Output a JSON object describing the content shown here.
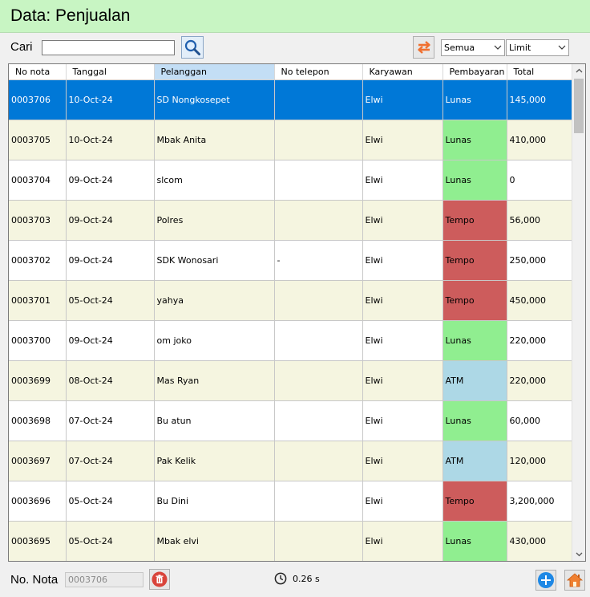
{
  "window": {
    "title": "Data: Penjualan"
  },
  "toolbar": {
    "search_label": "Cari",
    "search_value": "",
    "status_filter": "Semua",
    "limit_filter": "Limit"
  },
  "table": {
    "columns": [
      "No nota",
      "Tanggal",
      "Pelanggan",
      "No telepon",
      "Karyawan",
      "Pembayaran",
      "Total"
    ],
    "sorted_column": "Pelanggan",
    "rows": [
      {
        "no_nota": "0003706",
        "tanggal": "10-Oct-24",
        "pelanggan": "SD Nongkosepet",
        "no_telepon": "",
        "karyawan": "Elwi",
        "pembayaran": "Lunas",
        "total": "145,000",
        "selected": true
      },
      {
        "no_nota": "0003705",
        "tanggal": "10-Oct-24",
        "pelanggan": "Mbak Anita",
        "no_telepon": "",
        "karyawan": "Elwi",
        "pembayaran": "Lunas",
        "total": "410,000"
      },
      {
        "no_nota": "0003704",
        "tanggal": "09-Oct-24",
        "pelanggan": "slcom",
        "no_telepon": "",
        "karyawan": "Elwi",
        "pembayaran": "Lunas",
        "total": "0"
      },
      {
        "no_nota": "0003703",
        "tanggal": "09-Oct-24",
        "pelanggan": "Polres",
        "no_telepon": "",
        "karyawan": "Elwi",
        "pembayaran": "Tempo",
        "total": "56,000"
      },
      {
        "no_nota": "0003702",
        "tanggal": "09-Oct-24",
        "pelanggan": "SDK Wonosari",
        "no_telepon": "-",
        "karyawan": "Elwi",
        "pembayaran": "Tempo",
        "total": "250,000"
      },
      {
        "no_nota": "0003701",
        "tanggal": "05-Oct-24",
        "pelanggan": "yahya",
        "no_telepon": "",
        "karyawan": "Elwi",
        "pembayaran": "Tempo",
        "total": "450,000"
      },
      {
        "no_nota": "0003700",
        "tanggal": "09-Oct-24",
        "pelanggan": "om joko",
        "no_telepon": "",
        "karyawan": "Elwi",
        "pembayaran": "Lunas",
        "total": "220,000"
      },
      {
        "no_nota": "0003699",
        "tanggal": "08-Oct-24",
        "pelanggan": "Mas Ryan",
        "no_telepon": "",
        "karyawan": "Elwi",
        "pembayaran": "ATM",
        "total": "220,000"
      },
      {
        "no_nota": "0003698",
        "tanggal": "07-Oct-24",
        "pelanggan": "Bu atun",
        "no_telepon": "",
        "karyawan": "Elwi",
        "pembayaran": "Lunas",
        "total": "60,000"
      },
      {
        "no_nota": "0003697",
        "tanggal": "07-Oct-24",
        "pelanggan": "Pak Kelik",
        "no_telepon": "",
        "karyawan": "Elwi",
        "pembayaran": "ATM",
        "total": "120,000"
      },
      {
        "no_nota": "0003696",
        "tanggal": "05-Oct-24",
        "pelanggan": "Bu Dini",
        "no_telepon": "",
        "karyawan": "Elwi",
        "pembayaran": "Tempo",
        "total": "3,200,000"
      },
      {
        "no_nota": "0003695",
        "tanggal": "05-Oct-24",
        "pelanggan": "Mbak elvi",
        "no_telepon": "",
        "karyawan": "Elwi",
        "pembayaran": "Lunas",
        "total": "430,000"
      }
    ]
  },
  "footer": {
    "nota_label": "No. Nota",
    "nota_value": "0003706",
    "timer": "0.26 s"
  },
  "colors": {
    "title_bg": "#c8f5c3",
    "selected_row": "#0078d7",
    "lunas": "#90ee90",
    "tempo": "#cd5c5c",
    "atm": "#add8e6"
  },
  "icons": [
    "search-icon",
    "refresh-icon",
    "chevron-down-icon",
    "trash-icon",
    "clock-icon",
    "plus-icon",
    "home-icon"
  ]
}
